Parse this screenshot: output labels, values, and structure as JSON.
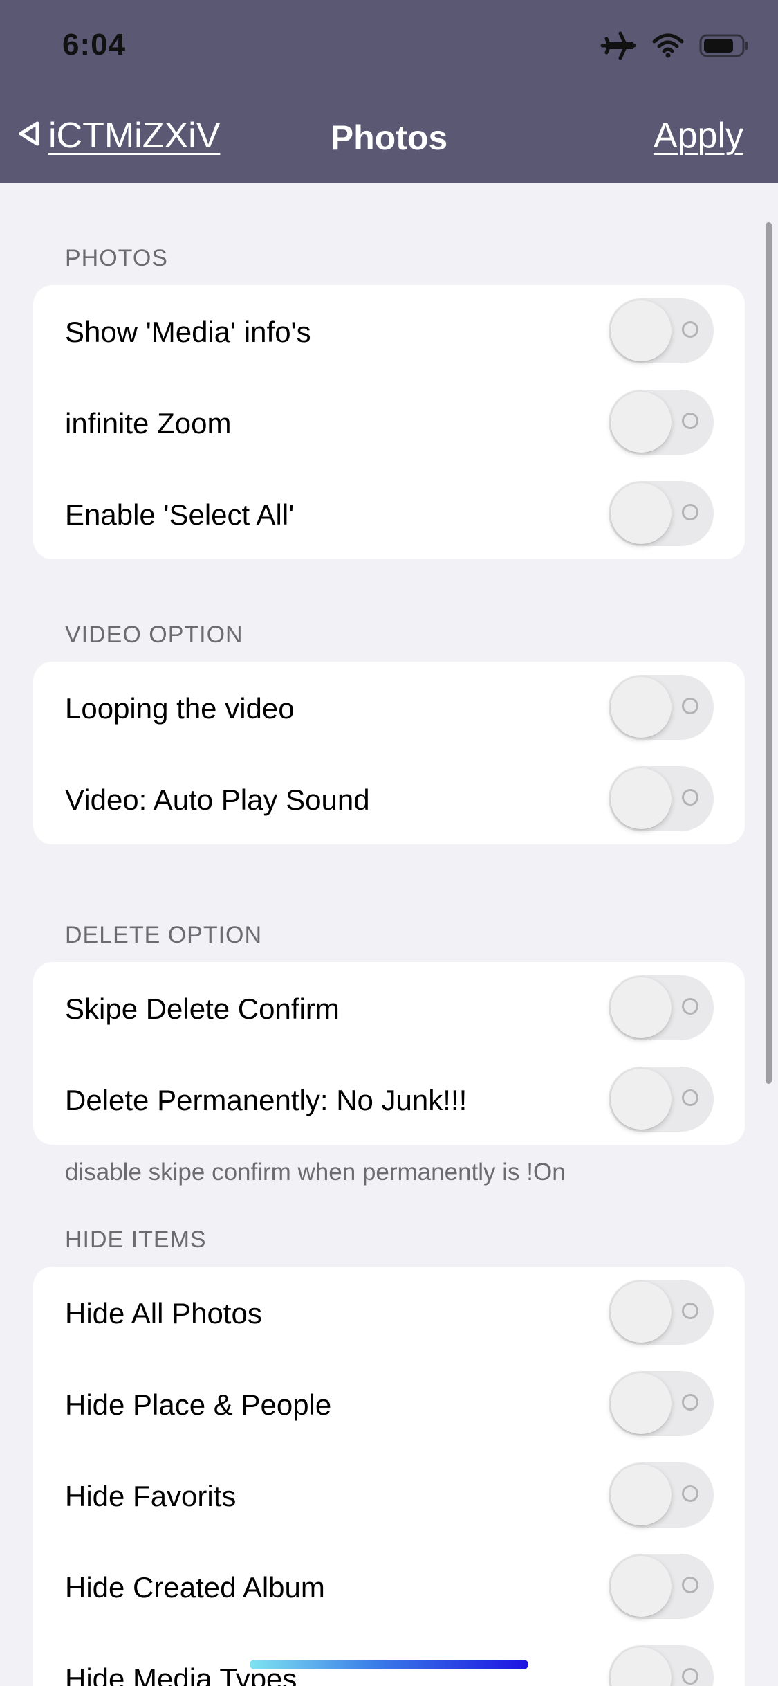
{
  "status_bar": {
    "time": "6:04",
    "icons": [
      "airplane-icon",
      "wifi-icon",
      "battery-icon"
    ]
  },
  "nav": {
    "back_label": "iCTMiZXiV",
    "title": "Photos",
    "apply_label": "Apply"
  },
  "sections": [
    {
      "header": "PHOTOS",
      "rows": [
        {
          "label": "Show 'Media' info's",
          "on": false
        },
        {
          "label": "infinite Zoom",
          "on": false
        },
        {
          "label": "Enable 'Select All'",
          "on": false
        }
      ]
    },
    {
      "header": "VIDEO OPTION",
      "rows": [
        {
          "label": "Looping the video",
          "on": false
        },
        {
          "label": "Video: Auto Play Sound",
          "on": false
        }
      ]
    },
    {
      "header": "DELETE OPTION",
      "rows": [
        {
          "label": "Skipe Delete Confirm",
          "on": false
        },
        {
          "label": "Delete Permanently: No Junk!!!",
          "on": false
        }
      ],
      "footer": "disable skipe confirm when permanently is !On"
    },
    {
      "header": "HIDE ITEMS",
      "rows": [
        {
          "label": "Hide All Photos",
          "on": false
        },
        {
          "label": "Hide Place & People",
          "on": false
        },
        {
          "label": "Hide Favorits",
          "on": false
        },
        {
          "label": "Hide Created Album",
          "on": false
        },
        {
          "label": "Hide Media Types",
          "on": false
        }
      ]
    }
  ],
  "colors": {
    "nav_background": "#5b5874",
    "page_background": "#f2f1f6",
    "group_background": "#ffffff",
    "toggle_off": "#e9e9eb",
    "section_text": "#6c6c70"
  }
}
